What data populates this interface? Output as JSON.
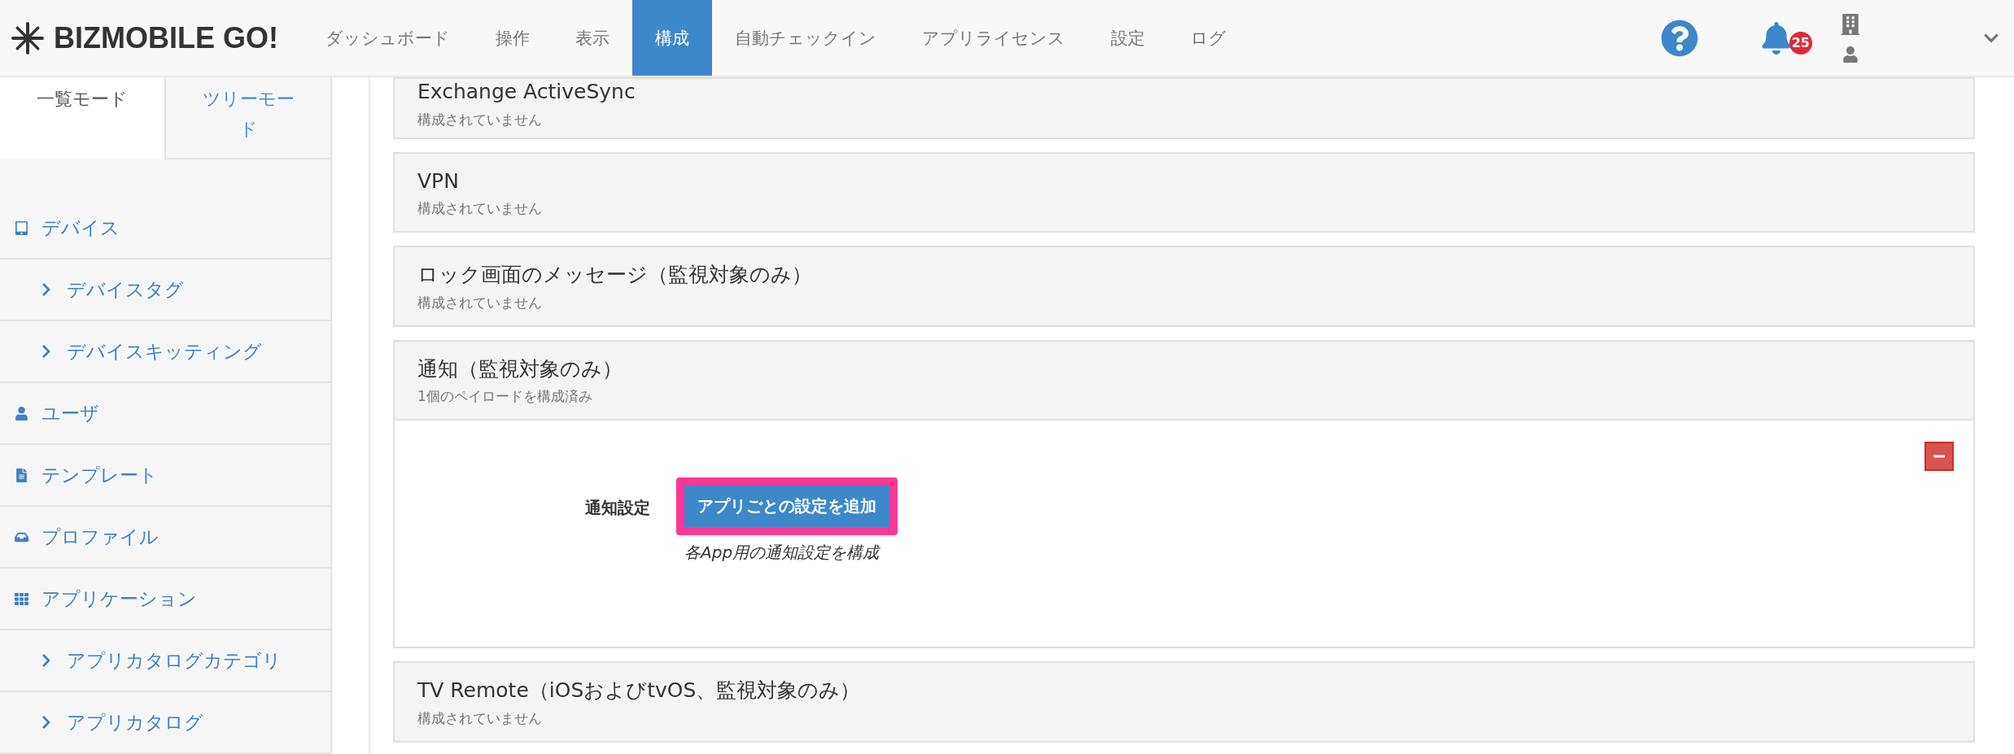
{
  "header": {
    "logo": "BIZMOBILE GO!",
    "nav": [
      {
        "label": "ダッシュボード",
        "selected": false
      },
      {
        "label": "操作",
        "selected": false
      },
      {
        "label": "表示",
        "selected": false
      },
      {
        "label": "構成",
        "selected": true
      },
      {
        "label": "自動チェックイン",
        "selected": false
      },
      {
        "label": "アプリライセンス",
        "selected": false
      },
      {
        "label": "設定",
        "selected": false
      },
      {
        "label": "ログ",
        "selected": false
      }
    ],
    "notification_count": "25"
  },
  "sidebar": {
    "tabs": [
      {
        "label": "一覧モード",
        "selected": true
      },
      {
        "label": "ツリーモード",
        "selected": false
      }
    ],
    "items": [
      {
        "label": "デバイス",
        "kind": "section"
      },
      {
        "label": "デバイスタグ",
        "kind": "sub"
      },
      {
        "label": "デバイスキッティング",
        "kind": "sub"
      },
      {
        "label": "ユーザ",
        "kind": "section"
      },
      {
        "label": "テンプレート",
        "kind": "section"
      },
      {
        "label": "プロファイル",
        "kind": "section"
      },
      {
        "label": "アプリケーション",
        "kind": "section"
      },
      {
        "label": "アプリカタログカテゴリ",
        "kind": "sub"
      },
      {
        "label": "アプリカタログ",
        "kind": "sub"
      }
    ]
  },
  "panels": [
    {
      "title": "Exchange ActiveSync",
      "status": "構成されていません",
      "expanded": false
    },
    {
      "title": "VPN",
      "status": "構成されていません",
      "expanded": false
    },
    {
      "title": "ロック画面のメッセージ（監視対象のみ）",
      "status": "構成されていません",
      "expanded": false
    },
    {
      "title": "通知（監視対象のみ）",
      "status": "1個のペイロードを構成済み",
      "expanded": true,
      "field_label": "通知設定",
      "button": "アプリごとの設定を追加",
      "button_highlighted": true,
      "help": "各App用の通知設定を構成"
    },
    {
      "title": "TV Remote（iOSおよびtvOS、監視対象のみ）",
      "status": "構成されていません",
      "expanded": false
    }
  ]
}
